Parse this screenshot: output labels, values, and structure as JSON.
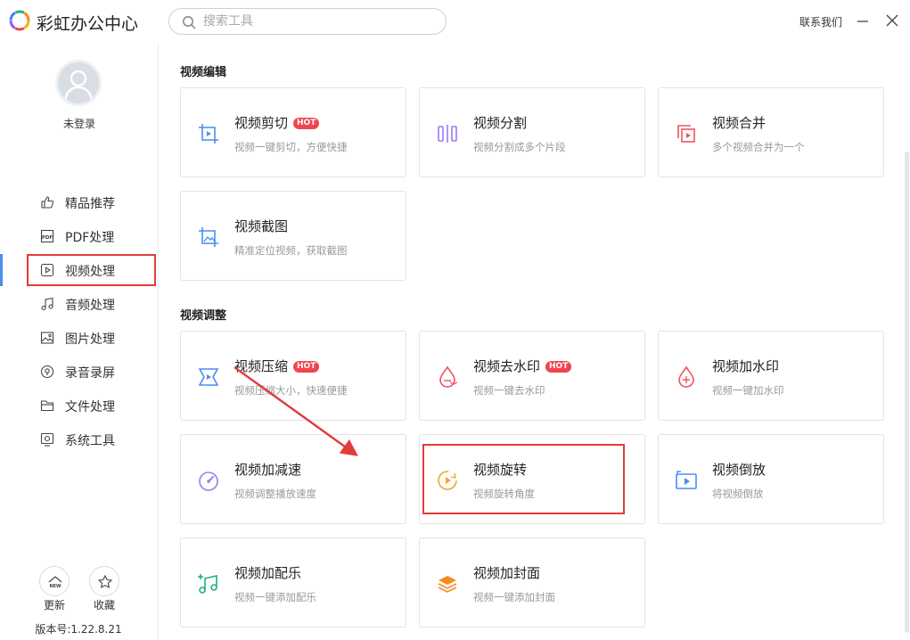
{
  "app": {
    "title": "彩虹办公中心"
  },
  "search": {
    "placeholder": "搜索工具"
  },
  "header": {
    "contact": "联系我们"
  },
  "user": {
    "login_text": "未登录"
  },
  "sidebar": {
    "items": [
      {
        "label": "精品推荐",
        "icon": "thumb-up-icon"
      },
      {
        "label": "PDF处理",
        "icon": "pdf-icon"
      },
      {
        "label": "视频处理",
        "icon": "video-play-icon",
        "active": true
      },
      {
        "label": "音频处理",
        "icon": "music-note-icon"
      },
      {
        "label": "图片处理",
        "icon": "image-icon"
      },
      {
        "label": "录音录屏",
        "icon": "record-icon"
      },
      {
        "label": "文件处理",
        "icon": "folder-icon"
      },
      {
        "label": "系统工具",
        "icon": "system-tool-icon"
      }
    ],
    "new_label": "更新",
    "new_badge": "NEW",
    "favorite_label": "收藏",
    "version": "版本号:1.22.8.21"
  },
  "sections": [
    {
      "title": "视频编辑",
      "cards": [
        {
          "title": "视频剪切",
          "desc": "视频一键剪切，方便快捷",
          "hot": "HOT",
          "icon": "crop-video-icon"
        },
        {
          "title": "视频分割",
          "desc": "视频分割成多个片段",
          "icon": "split-video-icon"
        },
        {
          "title": "视频合并",
          "desc": "多个视频合并为一个",
          "icon": "merge-video-icon"
        },
        {
          "title": "视频截图",
          "desc": "精准定位视频，获取截图",
          "icon": "screenshot-video-icon"
        }
      ]
    },
    {
      "title": "视频调整",
      "cards": [
        {
          "title": "视频压缩",
          "desc": "视频压缩大小，快速便捷",
          "hot": "HOT",
          "icon": "compress-video-icon"
        },
        {
          "title": "视频去水印",
          "desc": "视频一键去水印",
          "hot": "HOT",
          "icon": "remove-watermark-icon"
        },
        {
          "title": "视频加水印",
          "desc": "视频一键加水印",
          "icon": "add-watermark-icon"
        },
        {
          "title": "视频加减速",
          "desc": "视频调整播放速度",
          "icon": "speed-gauge-icon"
        },
        {
          "title": "视频旋转",
          "desc": "视频旋转角度",
          "icon": "rotate-video-icon"
        },
        {
          "title": "视频倒放",
          "desc": "将视频倒放",
          "icon": "reverse-video-icon"
        },
        {
          "title": "视频加配乐",
          "desc": "视频一键添加配乐",
          "icon": "add-music-icon"
        },
        {
          "title": "视频加封面",
          "desc": "视频一键添加封面",
          "icon": "add-cover-icon"
        }
      ]
    }
  ],
  "colors": {
    "accent": "#4a8ef0",
    "hot": "#f0454f",
    "annotation": "#e23b3b"
  }
}
